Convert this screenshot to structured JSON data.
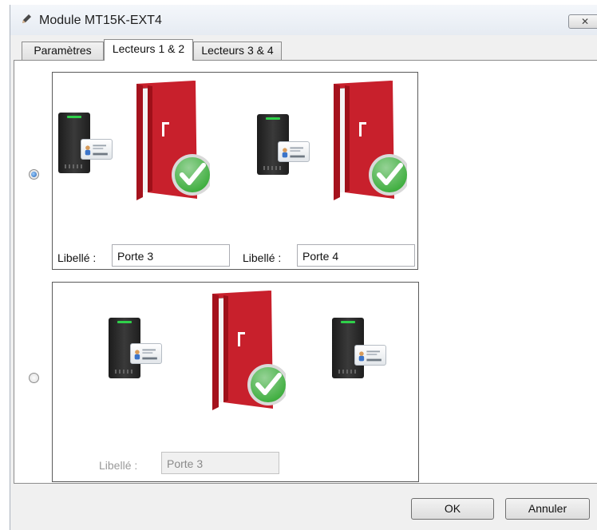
{
  "window": {
    "title": "Module MT15K-EXT4"
  },
  "tabs": [
    {
      "label": "Paramètres",
      "active": false
    },
    {
      "label": "Lecteurs 1 & 2",
      "active": true
    },
    {
      "label": "Lecteurs 3 & 4",
      "active": false
    }
  ],
  "options": [
    {
      "selected": true,
      "fields": [
        {
          "label": "Libellé :",
          "value": "Porte 3"
        },
        {
          "label": "Libellé :",
          "value": "Porte 4"
        }
      ]
    },
    {
      "selected": false,
      "fields": [
        {
          "label": "Libellé :",
          "value": "Porte 3",
          "disabled": true
        }
      ]
    }
  ],
  "buttons": {
    "ok": "OK",
    "cancel": "Annuler"
  },
  "colors": {
    "door": "#c8202c",
    "check": "#3fae3f",
    "reader_led": "#2fd14a"
  },
  "icons": [
    "pencil-icon",
    "close-icon",
    "card-reader-icon",
    "badge-card-icon",
    "open-door-icon",
    "check-icon"
  ]
}
